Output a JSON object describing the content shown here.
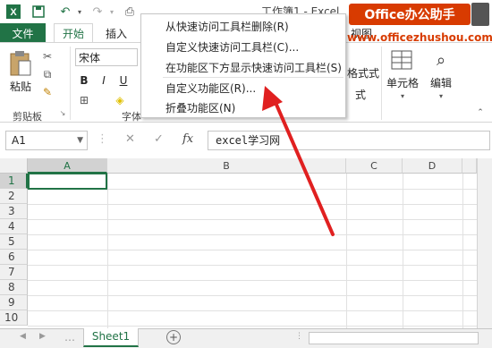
{
  "titlebar": {
    "title": "工作簿1 - Excel"
  },
  "tabs": {
    "file": "文件",
    "home": "开始",
    "insert": "插入",
    "view": "视图"
  },
  "ribbon": {
    "clipboard": {
      "paste": "粘贴",
      "group_label": "剪贴板"
    },
    "font": {
      "font_name": "宋体",
      "bold": "B",
      "italic": "I",
      "underline": "U",
      "group_label": "字体"
    },
    "styles": {
      "cell_format": "格式式",
      "table_format": "式"
    },
    "cells": {
      "label": "单元格"
    },
    "editing": {
      "label": "编辑"
    }
  },
  "formula_bar": {
    "name_box": "A1",
    "cancel": "✕",
    "enter": "✓",
    "fx": "fx",
    "value": "excel学习网"
  },
  "grid": {
    "columns": [
      "A",
      "B",
      "C",
      "D"
    ],
    "rows": [
      "1",
      "2",
      "3",
      "4",
      "5",
      "6",
      "7",
      "8",
      "9",
      "10"
    ]
  },
  "sheet_tabs": {
    "sheets": [
      "Sheet1"
    ],
    "add": "+"
  },
  "context_menu": {
    "items": [
      "从快速访问工具栏删除(R)",
      "自定义快速访问工具栏(C)...",
      "在功能区下方显示快速访问工具栏(S)",
      "自定义功能区(R)...",
      "折叠功能区(N)"
    ]
  },
  "watermark": {
    "badge": "Office办公助手",
    "url": "www.officezhushou.com"
  },
  "colors": {
    "excel_green": "#217346",
    "watermark_orange": "#d83b01",
    "arrow_red": "#e02020"
  }
}
